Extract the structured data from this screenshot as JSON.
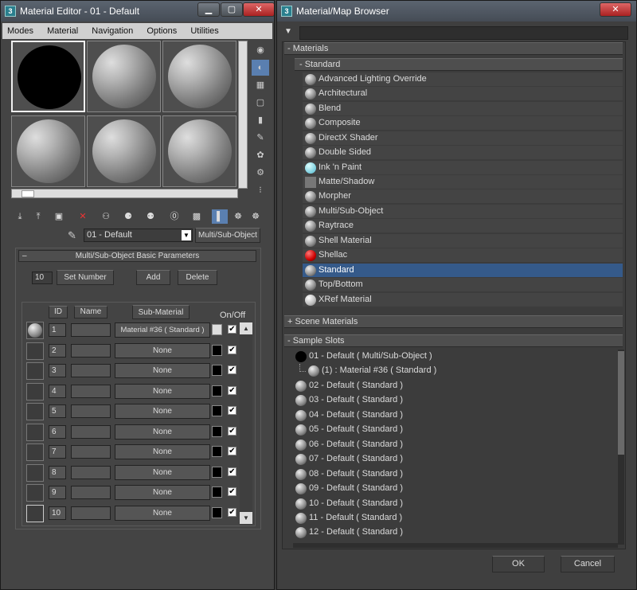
{
  "editor": {
    "title": "Material Editor - 01 - Default",
    "menu": [
      "Modes",
      "Material",
      "Navigation",
      "Options",
      "Utilities"
    ],
    "material_name": "01 - Default",
    "material_type": "Multi/Sub-Object",
    "rollout_title": "Multi/Sub-Object Basic Parameters",
    "count": "10",
    "set_number": "Set Number",
    "add": "Add",
    "delete": "Delete",
    "col_id": "ID",
    "col_name": "Name",
    "col_sub": "Sub-Material",
    "col_onoff": "On/Off",
    "rows": [
      {
        "id": "1",
        "sub": "Material #36  ( Standard )"
      },
      {
        "id": "2",
        "sub": "None"
      },
      {
        "id": "3",
        "sub": "None"
      },
      {
        "id": "4",
        "sub": "None"
      },
      {
        "id": "5",
        "sub": "None"
      },
      {
        "id": "6",
        "sub": "None"
      },
      {
        "id": "7",
        "sub": "None"
      },
      {
        "id": "8",
        "sub": "None"
      },
      {
        "id": "9",
        "sub": "None"
      },
      {
        "id": "10",
        "sub": "None"
      }
    ],
    "check": "✔",
    "minimize": "▁",
    "maximize": "▢",
    "close": "✕"
  },
  "browser": {
    "title": "Material/Map Browser",
    "close": "✕",
    "sec_materials": "- Materials",
    "sec_standard": "- Standard",
    "materials": [
      "Advanced Lighting Override",
      "Architectural",
      "Blend",
      "Composite",
      "DirectX Shader",
      "Double Sided",
      "Ink 'n Paint",
      "Matte/Shadow",
      "Morpher",
      "Multi/Sub-Object",
      "Raytrace",
      "Shell Material",
      "Shellac",
      "Standard",
      "Top/Bottom",
      "XRef Material"
    ],
    "sec_scene": "+ Scene Materials",
    "sec_sample": "- Sample Slots",
    "slots": [
      "01 - Default  ( Multi/Sub-Object )",
      "(1) : Material #36  ( Standard )",
      "02 - Default  ( Standard )",
      "03 - Default  ( Standard )",
      "04 - Default  ( Standard )",
      "05 - Default  ( Standard )",
      "06 - Default  ( Standard )",
      "07 - Default  ( Standard )",
      "08 - Default  ( Standard )",
      "09 - Default  ( Standard )",
      "10 - Default  ( Standard )",
      "11 - Default  ( Standard )",
      "12 - Default  ( Standard )"
    ],
    "ok": "OK",
    "cancel": "Cancel"
  }
}
